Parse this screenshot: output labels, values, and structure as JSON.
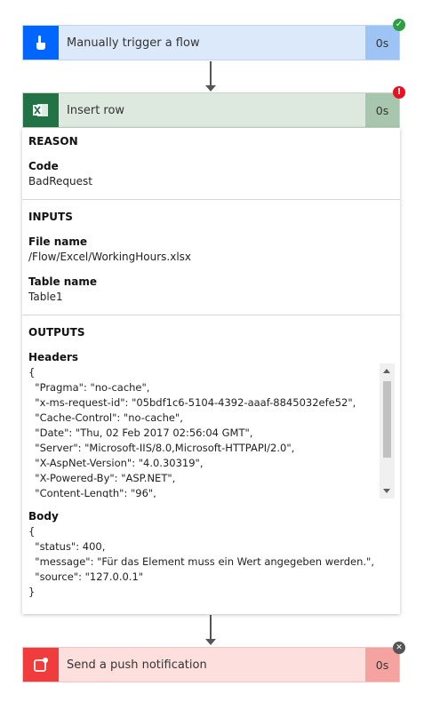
{
  "steps": {
    "trigger": {
      "title": "Manually trigger a flow",
      "duration": "0s",
      "status": "success"
    },
    "insert": {
      "title": "Insert row",
      "duration": "0s",
      "status": "error"
    },
    "push": {
      "title": "Send a push notification",
      "duration": "0s",
      "status": "skipped"
    }
  },
  "reason": {
    "heading": "REASON",
    "code_label": "Code",
    "code_value": "BadRequest"
  },
  "inputs": {
    "heading": "INPUTS",
    "file_label": "File name",
    "file_value": "/Flow/Excel/WorkingHours.xlsx",
    "table_label": "Table name",
    "table_value": "Table1"
  },
  "outputs": {
    "heading": "OUTPUTS",
    "headers_label": "Headers",
    "headers_lines": [
      "{",
      "  \"Pragma\": \"no-cache\",",
      "  \"x-ms-request-id\": \"05bdf1c6-5104-4392-aaaf-8845032efe52\",",
      "  \"Cache-Control\": \"no-cache\",",
      "  \"Date\": \"Thu, 02 Feb 2017 02:56:04 GMT\",",
      "  \"Server\": \"Microsoft-IIS/8.0,Microsoft-HTTPAPI/2.0\",",
      "  \"X-AspNet-Version\": \"4.0.30319\",",
      "  \"X-Powered-By\": \"ASP.NET\",",
      "  \"Content-Length\": \"96\","
    ],
    "body_label": "Body",
    "body_lines": [
      "{",
      "  \"status\": 400,",
      "  \"message\": \"Für das Element muss ein Wert angegeben werden.\",",
      "  \"source\": \"127.0.0.1\"",
      "}"
    ]
  },
  "colors": {
    "trigger_accent": "#0066ff",
    "trigger_bg": "#dce9fb",
    "trigger_dur_bg": "#9ec3f5",
    "excel_accent": "#217346",
    "excel_bg": "#dde8de",
    "excel_dur_bg": "#a8c6ad",
    "push_accent": "#f03c3c",
    "push_bg": "#fde0de",
    "push_dur_bg": "#f5a3a0",
    "success": "#2e9e44",
    "error": "#e81123",
    "skipped": "#555555"
  },
  "icons": {
    "trigger": "hand-tap-icon",
    "insert": "excel-icon",
    "push": "notification-icon",
    "success": "checkmark-icon",
    "error": "exclamation-icon",
    "skipped": "close-icon"
  }
}
